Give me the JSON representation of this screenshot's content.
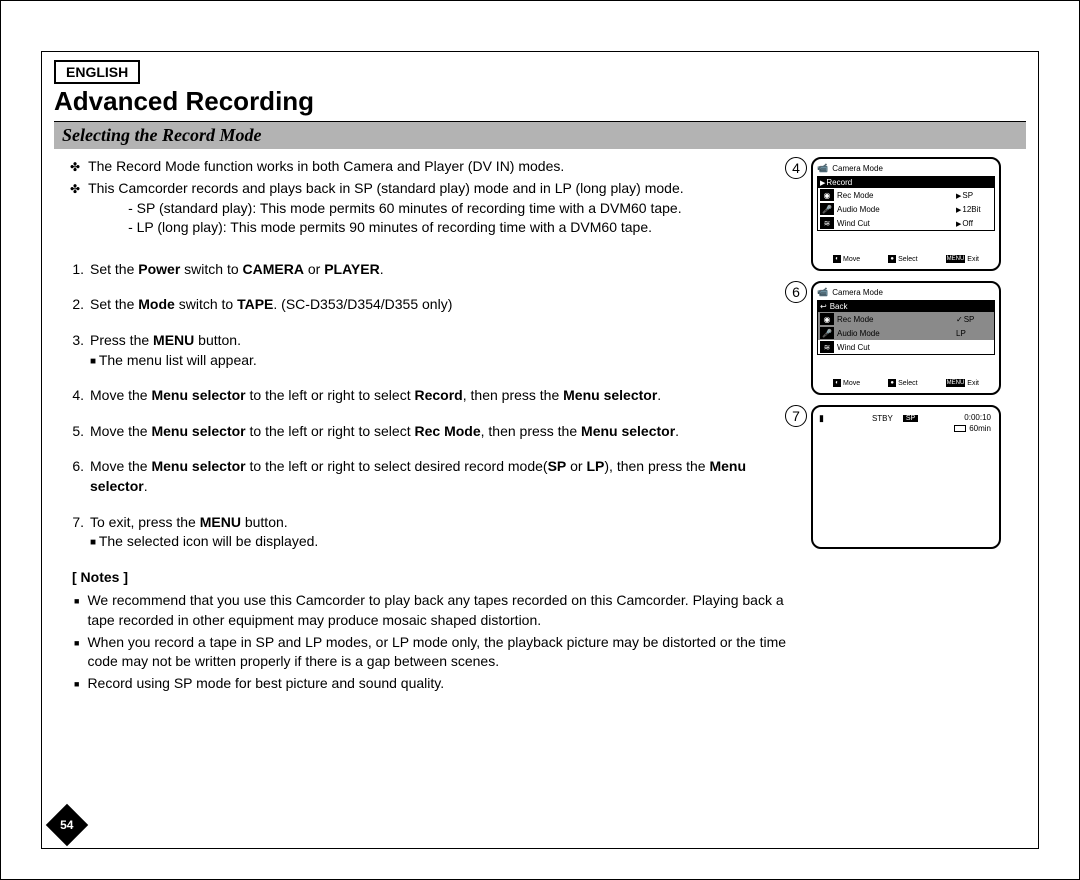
{
  "language_badge": "ENGLISH",
  "title": "Advanced Recording",
  "subtitle": "Selecting the Record Mode",
  "page_number": "54",
  "intro": {
    "line1": "The Record Mode function works in both Camera and Player (DV IN) modes.",
    "line2": "This Camcorder records and plays back in SP (standard play) mode and in LP (long play) mode.",
    "sub1": "SP (standard play): This mode permits 60 minutes of recording time with a DVM60 tape.",
    "sub2": "LP (long play): This mode permits 90 minutes of recording time with a DVM60 tape."
  },
  "steps": {
    "s1a": "Set the ",
    "s1b": "Power",
    "s1c": " switch to ",
    "s1d": "CAMERA",
    "s1e": " or ",
    "s1f": "PLAYER",
    "s1g": ".",
    "s2a": "Set the ",
    "s2b": "Mode",
    "s2c": " switch to ",
    "s2d": "TAPE",
    "s2e": ". (SC-D353/D354/D355 only)",
    "s3a": "Press the ",
    "s3b": "MENU",
    "s3c": " button.",
    "s3sub": "The menu list will appear.",
    "s4a": "Move the ",
    "s4b": "Menu selector",
    "s4c": " to the left or right to select ",
    "s4d": "Record",
    "s4e": ", then press the ",
    "s4f": "Menu selector",
    "s4g": ".",
    "s5a": "Move the ",
    "s5b": "Menu selector",
    "s5c": " to the left or right to select ",
    "s5d": "Rec Mode",
    "s5e": ", then press the ",
    "s5f": "Menu selector",
    "s5g": ".",
    "s6a": "Move the ",
    "s6b": "Menu selector",
    "s6c": " to the left or right to select desired record mode(",
    "s6d": "SP",
    "s6e": " or ",
    "s6f": "LP",
    "s6g": "), then press the ",
    "s6h": "Menu selector",
    "s6i": ".",
    "s7a": "To exit, press the ",
    "s7b": "MENU",
    "s7c": " button.",
    "s7sub": "The selected icon will be displayed."
  },
  "notes_label": "[ Notes ]",
  "notes": {
    "n1": "We recommend that you use this Camcorder to play back any tapes recorded on this Camcorder. Playing back a tape recorded in other equipment may produce mosaic shaped distortion.",
    "n2": "When you record a tape in SP and LP modes, or LP mode only, the playback picture may be distorted or the time code may not be written properly if there is a gap between scenes.",
    "n3": "Record using SP mode for best picture and sound quality."
  },
  "screens": {
    "shot4_num": "4",
    "shot6_num": "6",
    "shot7_num": "7",
    "camera_mode": "Camera Mode",
    "record_header": "Record",
    "back_header": "Back",
    "rec_mode": "Rec Mode",
    "audio_mode": "Audio Mode",
    "wind_cut": "Wind Cut",
    "val_sp": "SP",
    "val_lp": "LP",
    "val_12bit": "12Bit",
    "val_off": "Off",
    "hint_move": "Move",
    "hint_select": "Select",
    "hint_exit": "Exit",
    "hint_menu": "MENU",
    "stby": "STBY",
    "sp_badge": "SP",
    "timecode": "0:00:10",
    "remaining": "60min"
  }
}
